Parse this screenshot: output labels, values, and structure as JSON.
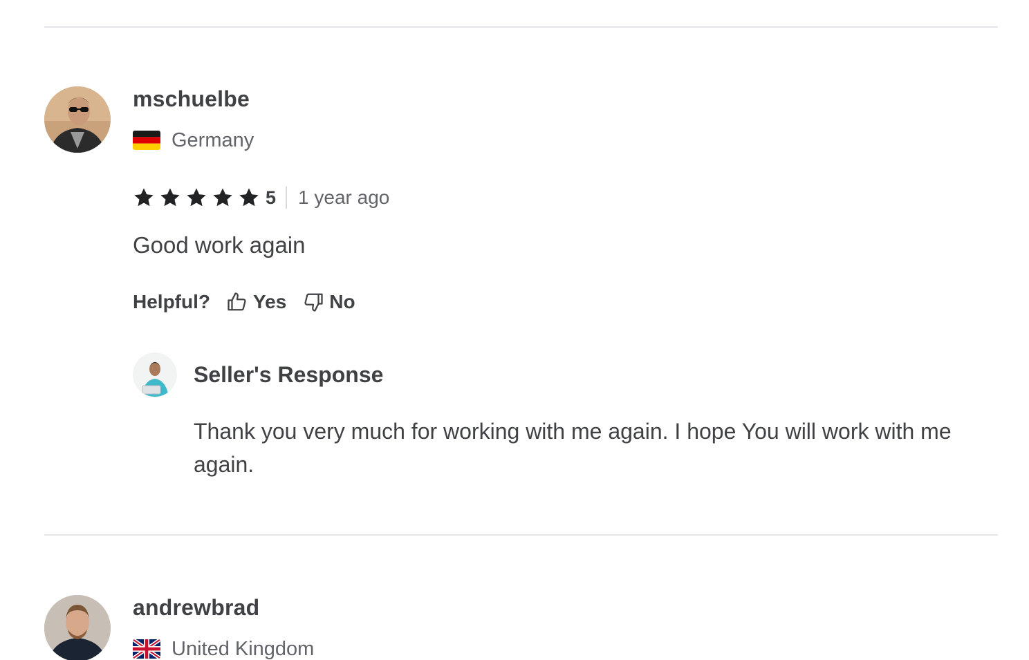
{
  "colors": {
    "text_primary": "#404145",
    "text_secondary": "#62646a",
    "divider": "#e4e5e7",
    "star": "#222325"
  },
  "reviews": [
    {
      "username": "mschuelbe",
      "country": "Germany",
      "flag": "germany-flag",
      "rating": "5",
      "stars": 5,
      "time_ago": "1 year ago",
      "text": "Good work again",
      "helpful_label": "Helpful?",
      "yes_label": "Yes",
      "no_label": "No",
      "seller_response": {
        "title": "Seller's Response",
        "text": "Thank you very much for working with me again. I hope You will work with me again."
      }
    },
    {
      "username": "andrewbrad",
      "country": "United Kingdom",
      "flag": "uk-flag"
    }
  ]
}
